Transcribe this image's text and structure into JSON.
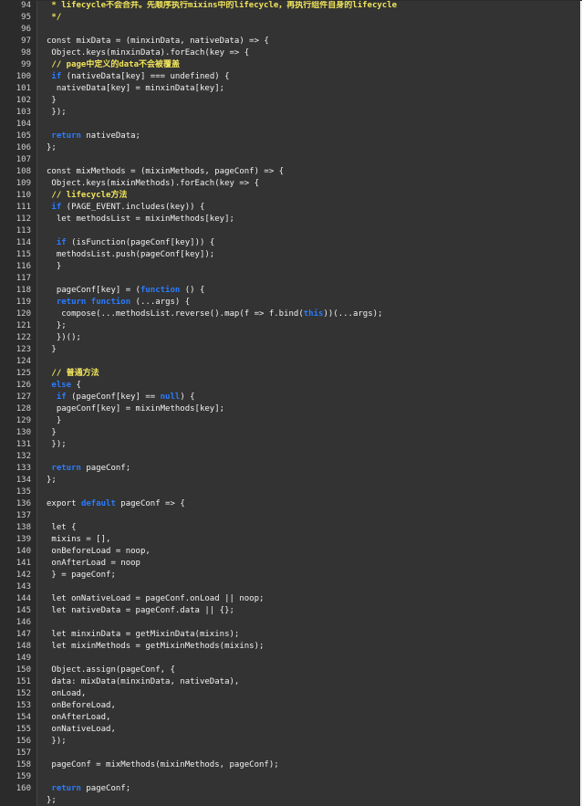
{
  "colors": {
    "background": "#333333",
    "gutter": "#2b2b2b",
    "line_number": "#cfcfcf",
    "text": "#f2f2f2",
    "keyword": "#2a7cff",
    "comment": "#f0e45b"
  },
  "code_lines": [
    {
      "n": "94",
      "tokens": [
        [
          " * lifecycle不会合并。先顺序执行mixins中的lifecycle，再执行组件自身的lifecycle",
          "com"
        ]
      ]
    },
    {
      "n": "95",
      "tokens": [
        [
          " */",
          "com"
        ]
      ]
    },
    {
      "n": "96",
      "tokens": []
    },
    {
      "n": "97",
      "tokens": [
        [
          "const mixData = (minxinData, nativeData) => {",
          "pl"
        ]
      ]
    },
    {
      "n": "98",
      "tokens": [
        [
          " Object.keys(minxinData).forEach(key => {",
          "pl"
        ]
      ]
    },
    {
      "n": "99",
      "tokens": [
        [
          " // page中定义的data不会被覆盖",
          "com"
        ]
      ]
    },
    {
      "n": "100",
      "tokens": [
        [
          " ",
          "pl"
        ],
        [
          "if",
          "kw"
        ],
        [
          " (nativeData[key] === undefined) {",
          "pl"
        ]
      ]
    },
    {
      "n": "101",
      "tokens": [
        [
          "  nativeData[key] = minxinData[key];",
          "pl"
        ]
      ]
    },
    {
      "n": "102",
      "tokens": [
        [
          " }",
          "pl"
        ]
      ]
    },
    {
      "n": "103",
      "tokens": [
        [
          " });",
          "pl"
        ]
      ]
    },
    {
      "n": "104",
      "tokens": []
    },
    {
      "n": "105",
      "tokens": [
        [
          " ",
          "pl"
        ],
        [
          "return",
          "kw"
        ],
        [
          " nativeData;",
          "pl"
        ]
      ]
    },
    {
      "n": "106",
      "tokens": [
        [
          "};",
          "pl"
        ]
      ]
    },
    {
      "n": "107",
      "tokens": []
    },
    {
      "n": "108",
      "tokens": [
        [
          "const mixMethods = (mixinMethods, pageConf) => {",
          "pl"
        ]
      ]
    },
    {
      "n": "109",
      "tokens": [
        [
          " Object.keys(mixinMethods).forEach(key => {",
          "pl"
        ]
      ]
    },
    {
      "n": "110",
      "tokens": [
        [
          " // lifecycle方法",
          "com"
        ]
      ]
    },
    {
      "n": "111",
      "tokens": [
        [
          " ",
          "pl"
        ],
        [
          "if",
          "kw"
        ],
        [
          " (PAGE_EVENT.includes(key)) {",
          "pl"
        ]
      ]
    },
    {
      "n": "112",
      "tokens": [
        [
          "  let methodsList = mixinMethods[key];",
          "pl"
        ]
      ]
    },
    {
      "n": "113",
      "tokens": []
    },
    {
      "n": "114",
      "tokens": [
        [
          "  ",
          "pl"
        ],
        [
          "if",
          "kw"
        ],
        [
          " (isFunction(pageConf[key])) {",
          "pl"
        ]
      ]
    },
    {
      "n": "115",
      "tokens": [
        [
          "  methodsList.push(pageConf[key]);",
          "pl"
        ]
      ]
    },
    {
      "n": "116",
      "tokens": [
        [
          "  }",
          "pl"
        ]
      ]
    },
    {
      "n": "117",
      "tokens": []
    },
    {
      "n": "118",
      "tokens": [
        [
          "  pageConf[key] = (",
          "pl"
        ],
        [
          "function",
          "kw"
        ],
        [
          " () {",
          "pl"
        ]
      ]
    },
    {
      "n": "119",
      "tokens": [
        [
          "  ",
          "pl"
        ],
        [
          "return",
          "kw"
        ],
        [
          " ",
          "pl"
        ],
        [
          "function",
          "kw"
        ],
        [
          " (...args) {",
          "pl"
        ]
      ]
    },
    {
      "n": "120",
      "tokens": [
        [
          "   compose(...methodsList.reverse().map(f => f.bind(",
          "pl"
        ],
        [
          "this",
          "kw"
        ],
        [
          "))(...args);",
          "pl"
        ]
      ]
    },
    {
      "n": "121",
      "tokens": [
        [
          "  };",
          "pl"
        ]
      ]
    },
    {
      "n": "122",
      "tokens": [
        [
          "  })();",
          "pl"
        ]
      ]
    },
    {
      "n": "123",
      "tokens": [
        [
          " }",
          "pl"
        ]
      ]
    },
    {
      "n": "124",
      "tokens": []
    },
    {
      "n": "125",
      "tokens": [
        [
          " // 普通方法",
          "com"
        ]
      ]
    },
    {
      "n": "126",
      "tokens": [
        [
          " ",
          "pl"
        ],
        [
          "else",
          "kw"
        ],
        [
          " {",
          "pl"
        ]
      ]
    },
    {
      "n": "127",
      "tokens": [
        [
          "  ",
          "pl"
        ],
        [
          "if",
          "kw"
        ],
        [
          " (pageConf[key] == ",
          "pl"
        ],
        [
          "null",
          "kw"
        ],
        [
          ") {",
          "pl"
        ]
      ]
    },
    {
      "n": "128",
      "tokens": [
        [
          "  pageConf[key] = mixinMethods[key];",
          "pl"
        ]
      ]
    },
    {
      "n": "129",
      "tokens": [
        [
          "  }",
          "pl"
        ]
      ]
    },
    {
      "n": "130",
      "tokens": [
        [
          " }",
          "pl"
        ]
      ]
    },
    {
      "n": "131",
      "tokens": [
        [
          " });",
          "pl"
        ]
      ]
    },
    {
      "n": "132",
      "tokens": []
    },
    {
      "n": "133",
      "tokens": [
        [
          " ",
          "pl"
        ],
        [
          "return",
          "kw"
        ],
        [
          " pageConf;",
          "pl"
        ]
      ]
    },
    {
      "n": "134",
      "tokens": [
        [
          "};",
          "pl"
        ]
      ]
    },
    {
      "n": "135",
      "tokens": []
    },
    {
      "n": "136",
      "tokens": [
        [
          "export ",
          "pl"
        ],
        [
          "default",
          "kw"
        ],
        [
          " pageConf => {",
          "pl"
        ]
      ]
    },
    {
      "n": "137",
      "tokens": []
    },
    {
      "n": "138",
      "tokens": [
        [
          " let {",
          "pl"
        ]
      ]
    },
    {
      "n": "139",
      "tokens": [
        [
          " mixins = [],",
          "pl"
        ]
      ]
    },
    {
      "n": "140",
      "tokens": [
        [
          " onBeforeLoad = noop,",
          "pl"
        ]
      ]
    },
    {
      "n": "141",
      "tokens": [
        [
          " onAfterLoad = noop",
          "pl"
        ]
      ]
    },
    {
      "n": "142",
      "tokens": [
        [
          " } = pageConf;",
          "pl"
        ]
      ]
    },
    {
      "n": "143",
      "tokens": []
    },
    {
      "n": "144",
      "tokens": [
        [
          " let onNativeLoad = pageConf.onLoad || noop;",
          "pl"
        ]
      ]
    },
    {
      "n": "145",
      "tokens": [
        [
          " let nativeData = pageConf.data || {};",
          "pl"
        ]
      ]
    },
    {
      "n": "146",
      "tokens": []
    },
    {
      "n": "147",
      "tokens": [
        [
          " let minxinData = getMixinData(mixins);",
          "pl"
        ]
      ]
    },
    {
      "n": "148",
      "tokens": [
        [
          " let mixinMethods = getMixinMethods(mixins);",
          "pl"
        ]
      ]
    },
    {
      "n": "149",
      "tokens": []
    },
    {
      "n": "150",
      "tokens": [
        [
          " Object.assign(pageConf, {",
          "pl"
        ]
      ]
    },
    {
      "n": "151",
      "tokens": [
        [
          " data: mixData(minxinData, nativeData),",
          "pl"
        ]
      ]
    },
    {
      "n": "152",
      "tokens": [
        [
          " onLoad,",
          "pl"
        ]
      ]
    },
    {
      "n": "153",
      "tokens": [
        [
          " onBeforeLoad,",
          "pl"
        ]
      ]
    },
    {
      "n": "154",
      "tokens": [
        [
          " onAfterLoad,",
          "pl"
        ]
      ]
    },
    {
      "n": "155",
      "tokens": [
        [
          " onNativeLoad,",
          "pl"
        ]
      ]
    },
    {
      "n": "156",
      "tokens": [
        [
          " });",
          "pl"
        ]
      ]
    },
    {
      "n": "157",
      "tokens": []
    },
    {
      "n": "158",
      "tokens": [
        [
          " pageConf = mixMethods(mixinMethods, pageConf);",
          "pl"
        ]
      ]
    },
    {
      "n": "159",
      "tokens": []
    },
    {
      "n": "160",
      "tokens": [
        [
          " ",
          "pl"
        ],
        [
          "return",
          "kw"
        ],
        [
          " pageConf;",
          "pl"
        ]
      ]
    },
    {
      "n": "",
      "tokens": [
        [
          "};",
          "pl"
        ]
      ]
    }
  ]
}
